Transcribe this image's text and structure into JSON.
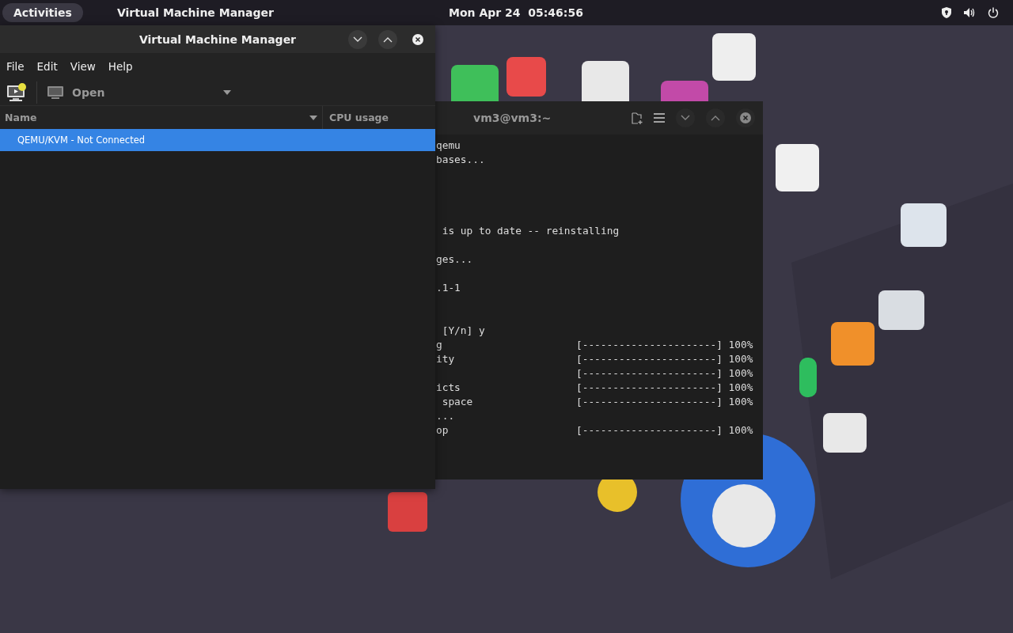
{
  "top_bar": {
    "activities": "Activities",
    "app_name": "Virtual Machine Manager",
    "clock": "Mon Apr 24  05:46:56"
  },
  "vmm_window": {
    "title": "Virtual Machine Manager",
    "menu": [
      "File",
      "Edit",
      "View",
      "Help"
    ],
    "toolbar": {
      "open_button": "Open",
      "open_disabled": true
    },
    "columns": [
      "Name",
      "CPU usage"
    ],
    "rows": [
      {
        "name": "QEMU/KVM - Not Connected",
        "selected": true
      }
    ]
  },
  "terminal_window": {
    "title": "vm3@vm3:~",
    "lines": [
      {
        "kind": "text",
        "text": "qemu"
      },
      {
        "kind": "text",
        "text": "bases..."
      },
      {
        "kind": "blank"
      },
      {
        "kind": "blank"
      },
      {
        "kind": "blank"
      },
      {
        "kind": "blank"
      },
      {
        "kind": "text",
        "text": " is up to date -- reinstalling"
      },
      {
        "kind": "blank"
      },
      {
        "kind": "text",
        "text": "ges..."
      },
      {
        "kind": "blank"
      },
      {
        "kind": "text",
        "text": ".1-1"
      },
      {
        "kind": "blank"
      },
      {
        "kind": "blank"
      },
      {
        "kind": "text",
        "text": " [Y/n] y"
      },
      {
        "kind": "progress",
        "text": "g",
        "bar": "[----------------------] 100%"
      },
      {
        "kind": "progress",
        "text": "ity",
        "bar": "[----------------------] 100%"
      },
      {
        "kind": "progress",
        "bar": "[----------------------] 100%"
      },
      {
        "kind": "progress",
        "text": "icts",
        "bar": "[----------------------] 100%"
      },
      {
        "kind": "progress",
        "text": " space",
        "bar": "[----------------------] 100%"
      },
      {
        "kind": "text",
        "text": "..."
      },
      {
        "kind": "progress",
        "text": "op",
        "bar": "[----------------------] 100%"
      }
    ]
  }
}
